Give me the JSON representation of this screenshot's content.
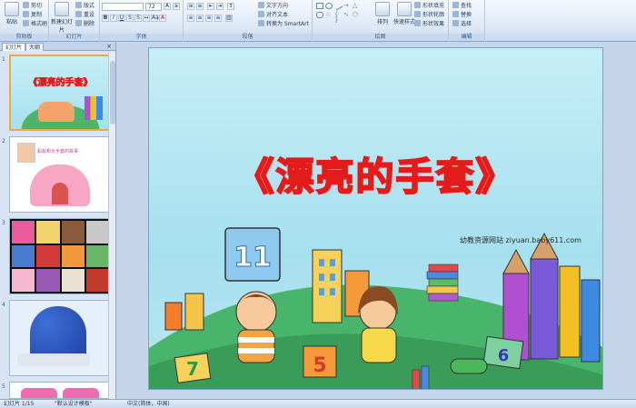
{
  "ribbon": {
    "clipboard": {
      "paste": "粘贴",
      "cut": "剪切",
      "copy": "复制",
      "format_painter": "格式刷",
      "label": "剪贴板"
    },
    "slides": {
      "new_slide": "新建幻灯片",
      "layout": "版式",
      "reset": "重设",
      "delete": "删除",
      "label": "幻灯片"
    },
    "font": {
      "font_name": "",
      "font_size": "72",
      "label": "字体"
    },
    "paragraph": {
      "text_direction": "文字方向",
      "align_text": "对齐文本",
      "convert_smartart": "转换为 SmartArt",
      "label": "段落"
    },
    "drawing": {
      "arrange": "排列",
      "quick_styles": "快速样式",
      "shape_fill": "形状填充",
      "shape_outline": "形状轮廓",
      "shape_effects": "形状效果",
      "label": "绘图"
    },
    "editing": {
      "find": "查找",
      "replace": "替换",
      "select": "选择",
      "label": "编辑"
    }
  },
  "panel": {
    "tab_slides": "幻灯片",
    "tab_outline": "大纲",
    "close": "×",
    "slides": [
      {
        "num": "1"
      },
      {
        "num": "2"
      },
      {
        "num": "3"
      },
      {
        "num": "4"
      },
      {
        "num": "5"
      }
    ],
    "thumb1_title": "《漂亮的手套》",
    "thumb2_title": "蚂蚁和大手套的故事"
  },
  "slide": {
    "title": "《漂亮的手套》",
    "watermark": "幼教资源网站  ziyuan.baby611.com"
  },
  "status": {
    "slide_counter": "幻灯片 1/15",
    "theme": "\"默认设计模板\"",
    "language": "中文(简体，中国)"
  },
  "colors": {
    "title_stroke": "#e31b1b",
    "slide_bg": "#a6e0ef",
    "ribbon": "#dbe7f5"
  }
}
